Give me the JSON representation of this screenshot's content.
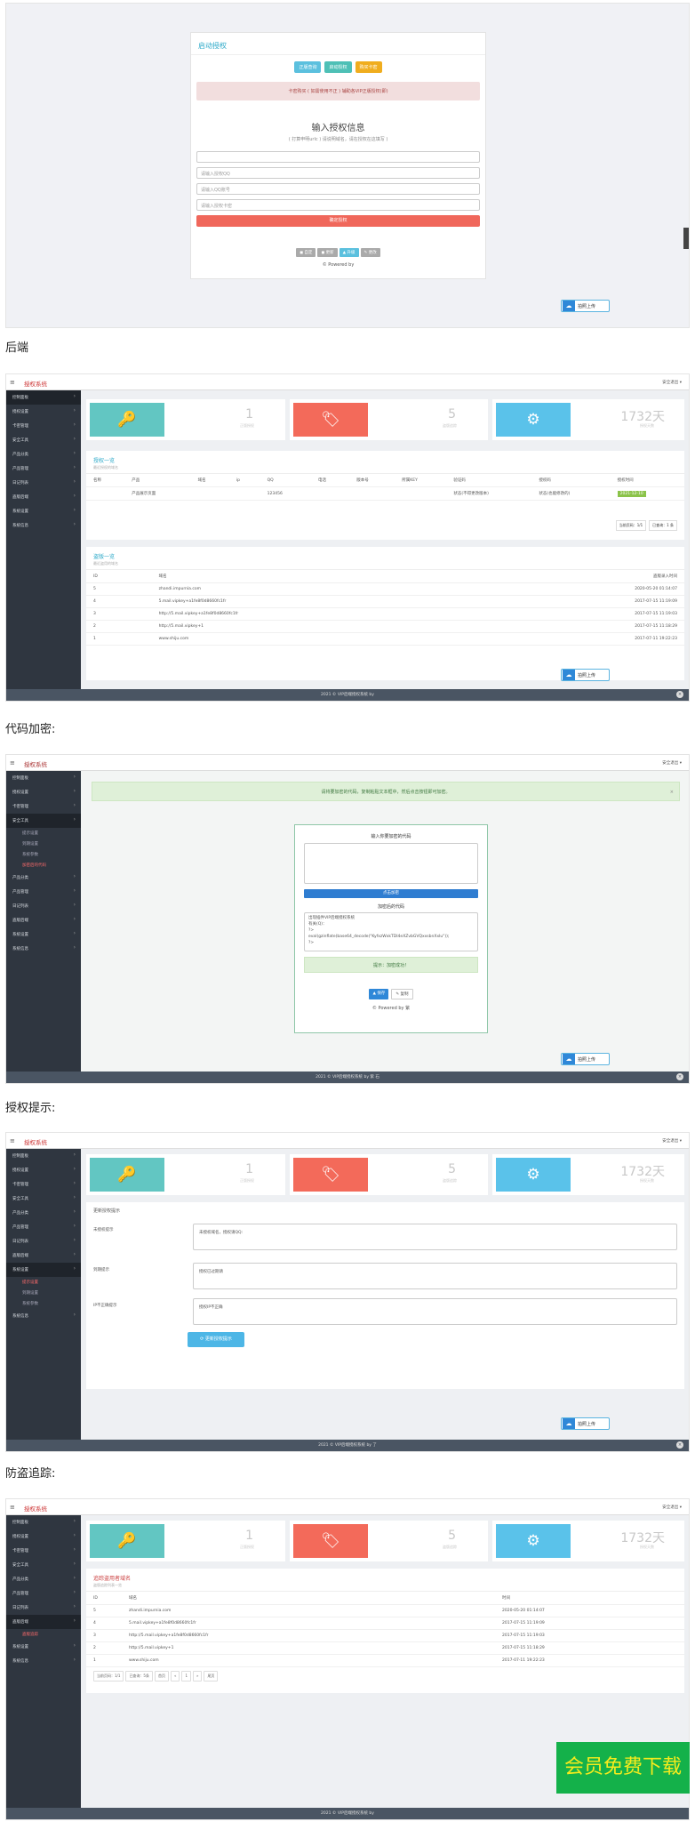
{
  "auth_page": {
    "card_title": "启动授权",
    "buttons": [
      "正版查询",
      "启动授权",
      "购买卡密"
    ],
    "notice": "卡密购买 ( 如需使用不正 ) 辅助各VIP正版授权(即)",
    "title": "输入授权信息",
    "subtitle": "( 打算申明urlc ) 请说明域名，请在授权在这填写 )",
    "inputs": [
      "",
      "请输入授权QQ",
      "请输入QQ账号",
      "请输入授权卡密"
    ],
    "submit": "确定授权",
    "tools": [
      "◼ 自定",
      "◼ 更新",
      "▲ 升级",
      "✎ 更改"
    ],
    "powered": "© Powered by",
    "upload": "拍照上传"
  },
  "labels": {
    "backend": "后端",
    "encrypt": "代码加密:",
    "tip": "授权提示:",
    "trace": "防盗追踪:"
  },
  "admin": {
    "menu_icon": "≡",
    "brand": "授权系统",
    "brand2": "授权系统",
    "exit": "安全退出 ▾",
    "sidebar": [
      "控制面板",
      "授权设置",
      "卡密管理",
      "安全工具",
      "产品分类",
      "产品管理",
      "日记列表",
      "盗版后端",
      "系统设置",
      "系统信息"
    ],
    "stats": [
      {
        "icon": "key-icon",
        "glyph": "🔑",
        "value": "1",
        "caption": "正版授权"
      },
      {
        "icon": "tag-icon",
        "glyph": "🏷",
        "value": "5",
        "caption": "盗版追踪"
      },
      {
        "icon": "gears-icon",
        "glyph": "⚙",
        "value": "1732天",
        "caption": "授权天数"
      }
    ],
    "footer": "2021 © VIP后端授权系统 by",
    "footer3": "2021 © VIP后端授权系统 by 紫 石",
    "footer4": "2021 © VIP后端授权系统 by 了",
    "footer5": "2021 © VIP后端授权系统 by"
  },
  "license_list": {
    "title": "授权一览",
    "sub": "最近授权的域名",
    "headers": [
      "名称",
      "产品",
      "域名",
      "ip",
      "QQ",
      "电话",
      "版本号",
      "所属KEY",
      "验证码",
      "授权码",
      "授权时间"
    ],
    "row": [
      "",
      "产品展示页面",
      "",
      "",
      "123456",
      "",
      "",
      "",
      "状态(不得更改版本)",
      "状态(也能修改的)",
      "2021-12-10"
    ],
    "pager": [
      "当前页码：1/1",
      "已查询：1 条"
    ]
  },
  "pirate_list": {
    "title": "盗版一览",
    "sub": "最近盗用的域名",
    "headers": [
      "ID",
      "域名",
      "盗版录入时间"
    ],
    "rows": [
      [
        "5",
        "zhandi.impurnia.com",
        "2020-05-20 01:14:07"
      ],
      [
        "4",
        "5.mail.vipkey+a1fe8f0d8660fc1fr",
        "2017-07-15 11:19:09"
      ],
      [
        "3",
        "http://5.mail.vipkey+a1fe8f0d8660fc1fr",
        "2017-07-15 11:19:03"
      ],
      [
        "2",
        "http://5.mail.vipkey+1",
        "2017-07-15 11:18:29"
      ],
      [
        "1",
        "www.shiju.com",
        "2017-07-11 19:22:23"
      ]
    ]
  },
  "encrypt": {
    "alert": "请将要加密的代码，复制粘贴文本框中，然后点击按钮即可加密。",
    "label_in": "输入你要加密的代码",
    "encrypt_btn": "点击加密",
    "label_out": "加密后的代码",
    "output": [
      "出现插件VIP后端授权系统",
      "有关(Q)：",
      "?>",
      "eval(gzinflate(base64_decode(\"KyfxzWxkTDI4eXZvbGVQxxsbnXxIu\"));",
      "?>"
    ],
    "success": "提示：加密成功！",
    "btn_save": "▲ 保存",
    "btn_copy": "✎ 复制",
    "powered": "© Powered by 紫"
  },
  "tips": {
    "title": "更新授权提示",
    "rows": [
      {
        "label": "未授权提示",
        "value": "未授权域名，授权请QQ:"
      },
      {
        "label": "到期提示",
        "value": "授权已过期请"
      },
      {
        "label": "IP不正确提示",
        "value": "授权IP不正确"
      }
    ],
    "save": "⟳ 更新授权提示",
    "subs": [
      "提示设置",
      "到期设置",
      "系统参数"
    ]
  },
  "trace": {
    "title": "追踪盗用者域名",
    "sub": "盗版追踪列表一览",
    "headers": [
      "ID",
      "域名",
      "时间"
    ],
    "pager": [
      "当前页码：1/1",
      "已查询：5条",
      "首页",
      "«",
      "1",
      "»",
      "尾页"
    ],
    "sub_item": "盗版追踪"
  },
  "watermark": "会员免费下载",
  "colors": {
    "cyan": "#62c6c2",
    "salmon": "#f36a5a",
    "sky": "#5ac2ea",
    "sidebar": "#2f3640"
  }
}
